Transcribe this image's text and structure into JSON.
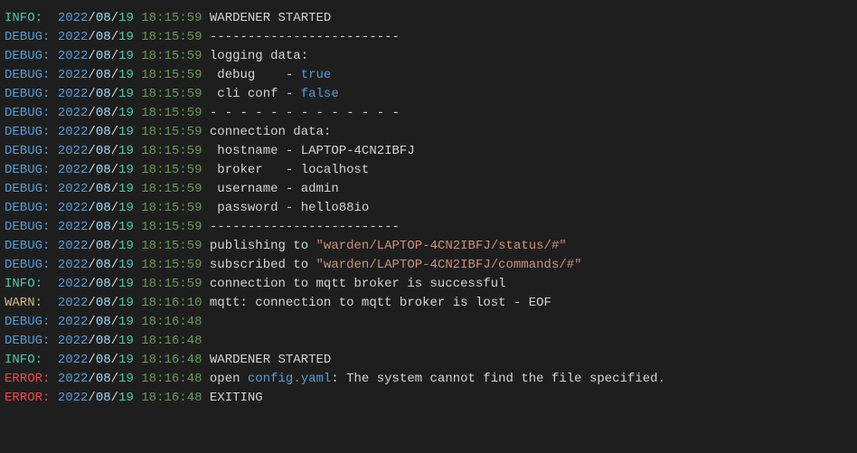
{
  "lines": [
    {
      "level": "INFO",
      "year": "2022",
      "month": "08",
      "day": "19",
      "time": "18:15:59",
      "segs": [
        {
          "cls": "msg",
          "text": "WARDENER STARTED"
        }
      ]
    },
    {
      "level": "DEBUG",
      "year": "2022",
      "month": "08",
      "day": "19",
      "time": "18:15:59",
      "segs": [
        {
          "cls": "msg",
          "text": "-------------------------"
        }
      ]
    },
    {
      "level": "DEBUG",
      "year": "2022",
      "month": "08",
      "day": "19",
      "time": "18:15:59",
      "segs": [
        {
          "cls": "msg",
          "text": "logging data:"
        }
      ]
    },
    {
      "level": "DEBUG",
      "year": "2022",
      "month": "08",
      "day": "19",
      "time": "18:15:59",
      "segs": [
        {
          "cls": "msg",
          "text": " debug    - "
        },
        {
          "cls": "bool",
          "text": "true"
        }
      ]
    },
    {
      "level": "DEBUG",
      "year": "2022",
      "month": "08",
      "day": "19",
      "time": "18:15:59",
      "segs": [
        {
          "cls": "msg",
          "text": " cli conf - "
        },
        {
          "cls": "bool",
          "text": "false"
        }
      ]
    },
    {
      "level": "DEBUG",
      "year": "2022",
      "month": "08",
      "day": "19",
      "time": "18:15:59",
      "segs": [
        {
          "cls": "msg",
          "text": "- - - - - - - - - - - - -"
        }
      ]
    },
    {
      "level": "DEBUG",
      "year": "2022",
      "month": "08",
      "day": "19",
      "time": "18:15:59",
      "segs": [
        {
          "cls": "msg",
          "text": "connection data:"
        }
      ]
    },
    {
      "level": "DEBUG",
      "year": "2022",
      "month": "08",
      "day": "19",
      "time": "18:15:59",
      "segs": [
        {
          "cls": "msg",
          "text": " hostname - LAPTOP-4CN2IBFJ"
        }
      ]
    },
    {
      "level": "DEBUG",
      "year": "2022",
      "month": "08",
      "day": "19",
      "time": "18:15:59",
      "segs": [
        {
          "cls": "msg",
          "text": " broker   - localhost"
        }
      ]
    },
    {
      "level": "DEBUG",
      "year": "2022",
      "month": "08",
      "day": "19",
      "time": "18:15:59",
      "segs": [
        {
          "cls": "msg",
          "text": " username - admin"
        }
      ]
    },
    {
      "level": "DEBUG",
      "year": "2022",
      "month": "08",
      "day": "19",
      "time": "18:15:59",
      "segs": [
        {
          "cls": "msg",
          "text": " password - hello88io"
        }
      ]
    },
    {
      "level": "DEBUG",
      "year": "2022",
      "month": "08",
      "day": "19",
      "time": "18:15:59",
      "segs": [
        {
          "cls": "msg",
          "text": "-------------------------"
        }
      ]
    },
    {
      "level": "DEBUG",
      "year": "2022",
      "month": "08",
      "day": "19",
      "time": "18:15:59",
      "segs": [
        {
          "cls": "msg",
          "text": "publishing to "
        },
        {
          "cls": "string",
          "text": "\"warden/LAPTOP-4CN2IBFJ/status/#\""
        }
      ]
    },
    {
      "level": "DEBUG",
      "year": "2022",
      "month": "08",
      "day": "19",
      "time": "18:15:59",
      "segs": [
        {
          "cls": "msg",
          "text": "subscribed to "
        },
        {
          "cls": "string",
          "text": "\"warden/LAPTOP-4CN2IBFJ/commands/#\""
        }
      ]
    },
    {
      "level": "INFO",
      "year": "2022",
      "month": "08",
      "day": "19",
      "time": "18:15:59",
      "segs": [
        {
          "cls": "msg",
          "text": "connection to mqtt broker is successful"
        }
      ]
    },
    {
      "level": "WARN",
      "year": "2022",
      "month": "08",
      "day": "19",
      "time": "18:16:10",
      "segs": [
        {
          "cls": "msg",
          "text": "mqtt: connection to mqtt broker is lost - EOF"
        }
      ]
    },
    {
      "level": "DEBUG",
      "year": "2022",
      "month": "08",
      "day": "19",
      "time": "18:16:48",
      "segs": []
    },
    {
      "level": "DEBUG",
      "year": "2022",
      "month": "08",
      "day": "19",
      "time": "18:16:48",
      "segs": []
    },
    {
      "level": "INFO",
      "year": "2022",
      "month": "08",
      "day": "19",
      "time": "18:16:48",
      "segs": [
        {
          "cls": "msg",
          "text": "WARDENER STARTED"
        }
      ]
    },
    {
      "level": "ERROR",
      "year": "2022",
      "month": "08",
      "day": "19",
      "time": "18:16:48",
      "segs": [
        {
          "cls": "msg",
          "text": "open "
        },
        {
          "cls": "filename",
          "text": "config.yaml"
        },
        {
          "cls": "msg",
          "text": ": The system cannot find the file specified."
        }
      ]
    },
    {
      "level": "ERROR",
      "year": "2022",
      "month": "08",
      "day": "19",
      "time": "18:16:48",
      "segs": [
        {
          "cls": "msg",
          "text": "EXITING"
        }
      ]
    }
  ]
}
